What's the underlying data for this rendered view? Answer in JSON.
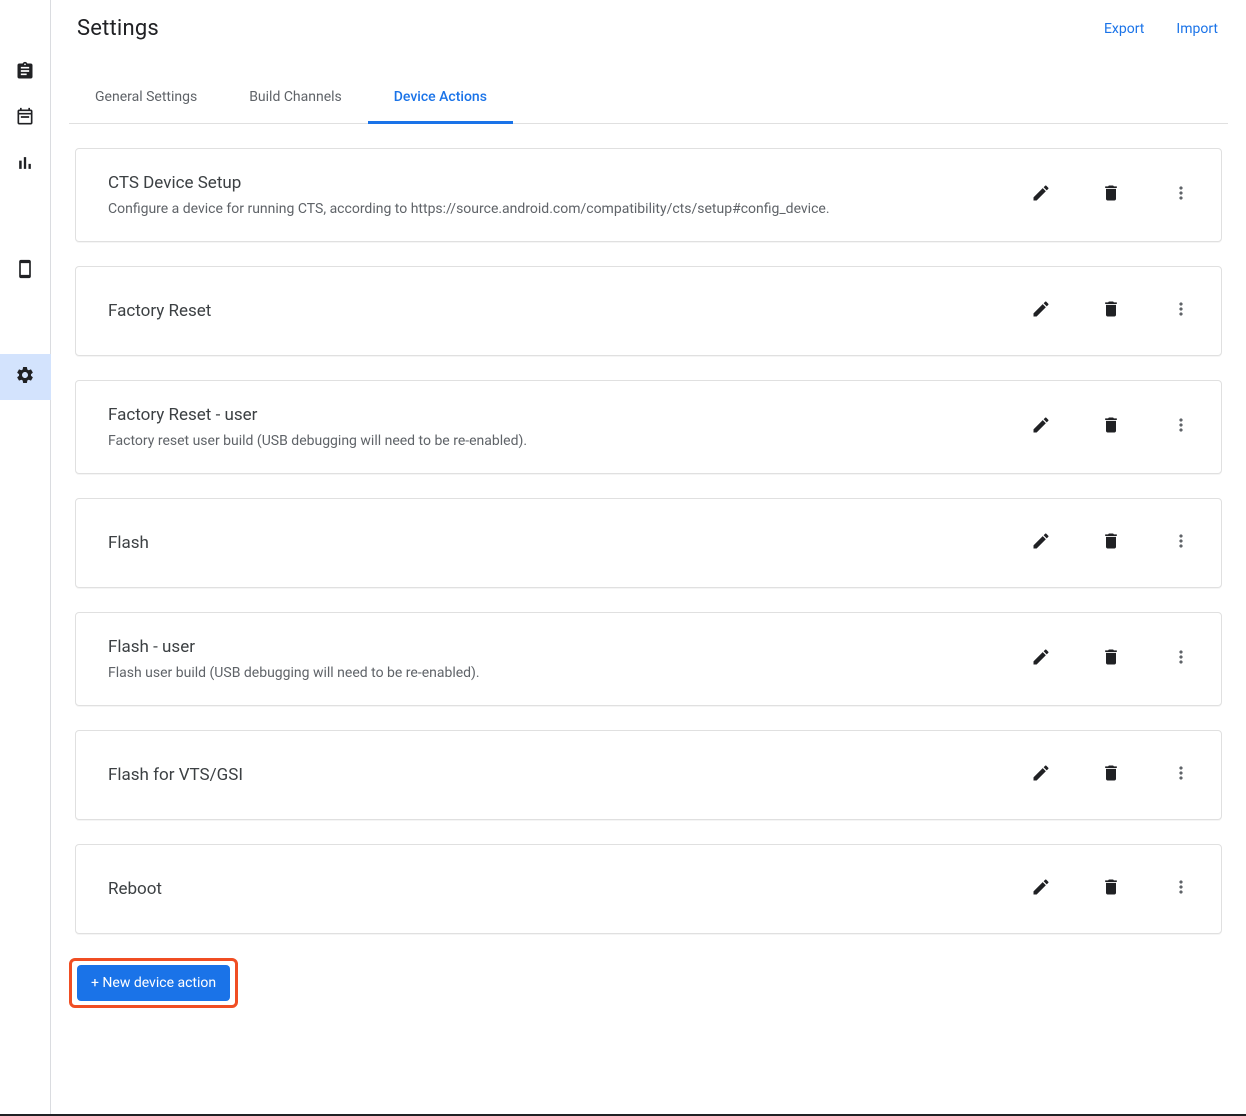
{
  "header": {
    "title": "Settings",
    "export": "Export",
    "import": "Import"
  },
  "tabs": [
    {
      "label": "General Settings",
      "active": false
    },
    {
      "label": "Build Channels",
      "active": false
    },
    {
      "label": "Device Actions",
      "active": true
    }
  ],
  "actions": [
    {
      "title": "CTS Device Setup",
      "desc": "Configure a device for running CTS, according to https://source.android.com/compatibility/cts/setup#config_device."
    },
    {
      "title": "Factory Reset",
      "desc": ""
    },
    {
      "title": "Factory Reset - user",
      "desc": "Factory reset user build (USB debugging will need to be re-enabled)."
    },
    {
      "title": "Flash",
      "desc": ""
    },
    {
      "title": "Flash - user",
      "desc": "Flash user build (USB debugging will need to be re-enabled)."
    },
    {
      "title": "Flash for VTS/GSI",
      "desc": ""
    },
    {
      "title": "Reboot",
      "desc": ""
    }
  ],
  "newButton": "+ New device action",
  "sidenav": {
    "items": [
      "clipboard",
      "calendar",
      "chart",
      "phone",
      "settings"
    ],
    "activeIndex": 4
  }
}
